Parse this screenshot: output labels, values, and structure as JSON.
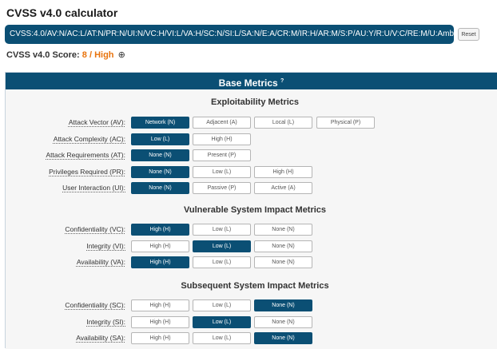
{
  "title": "CVSS v4.0 calculator",
  "vector": "CVSS:4.0/AV:N/AC:L/AT:N/PR:N/UI:N/VC:H/VI:L/VA:H/SC:N/SI:L/SA:N/E:A/CR:M/IR:H/AR:M/S:P/AU:Y/R:U/V:C/RE:M/U:Amber",
  "reset_label": "Reset",
  "score": {
    "label": "CVSS v4.0 Score:",
    "value": "8 / High",
    "expand_icon": "plus-circle-icon"
  },
  "panel": {
    "title": "Base Metrics",
    "help_marker": "?",
    "groups": [
      {
        "title": "Exploitability Metrics",
        "rows": [
          {
            "label": "Attack Vector (AV):",
            "options": [
              "Network (N)",
              "Adjacent (A)",
              "Local (L)",
              "Physical (P)"
            ],
            "selected": 0
          },
          {
            "label": "Attack Complexity (AC):",
            "options": [
              "Low (L)",
              "High (H)"
            ],
            "selected": 0
          },
          {
            "label": "Attack Requirements (AT):",
            "options": [
              "None (N)",
              "Present (P)"
            ],
            "selected": 0
          },
          {
            "label": "Privileges Required (PR):",
            "options": [
              "None (N)",
              "Low (L)",
              "High (H)"
            ],
            "selected": 0
          },
          {
            "label": "User Interaction (UI):",
            "options": [
              "None (N)",
              "Passive (P)",
              "Active (A)"
            ],
            "selected": 0
          }
        ]
      },
      {
        "title": "Vulnerable System Impact Metrics",
        "rows": [
          {
            "label": "Confidentiality (VC):",
            "options": [
              "High (H)",
              "Low (L)",
              "None (N)"
            ],
            "selected": 0
          },
          {
            "label": "Integrity (VI):",
            "options": [
              "High (H)",
              "Low (L)",
              "None (N)"
            ],
            "selected": 1
          },
          {
            "label": "Availability (VA):",
            "options": [
              "High (H)",
              "Low (L)",
              "None (N)"
            ],
            "selected": 0
          }
        ]
      },
      {
        "title": "Subsequent System Impact Metrics",
        "rows": [
          {
            "label": "Confidentiality (SC):",
            "options": [
              "High (H)",
              "Low (L)",
              "None (N)"
            ],
            "selected": 2
          },
          {
            "label": "Integrity (SI):",
            "options": [
              "High (H)",
              "Low (L)",
              "None (N)"
            ],
            "selected": 1
          },
          {
            "label": "Availability (SA):",
            "options": [
              "High (H)",
              "Low (L)",
              "None (N)"
            ],
            "selected": 2
          }
        ]
      }
    ]
  }
}
